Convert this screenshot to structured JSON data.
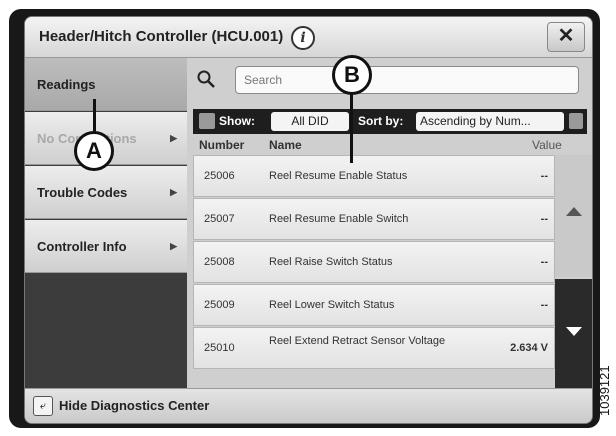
{
  "window": {
    "title": "Header/Hitch Controller (HCU.001)",
    "close_label": "✕"
  },
  "sidebar": {
    "items": [
      {
        "label": "Readings",
        "state": "active"
      },
      {
        "label": "No Connections",
        "state": "disabled"
      },
      {
        "label": "Trouble Codes",
        "state": "normal"
      },
      {
        "label": "Controller Info",
        "state": "normal"
      }
    ]
  },
  "search": {
    "placeholder": "Search"
  },
  "filter": {
    "show_label": "Show:",
    "show_value": "All DID",
    "sort_label": "Sort by:",
    "sort_value": "Ascending by Num..."
  },
  "table": {
    "headers": {
      "number": "Number",
      "name": "Name",
      "value": "Value"
    },
    "rows": [
      {
        "number": "25006",
        "name": "Reel Resume Enable Status",
        "value": "--"
      },
      {
        "number": "25007",
        "name": "Reel Resume Enable Switch",
        "value": "--"
      },
      {
        "number": "25008",
        "name": "Reel Raise Switch Status",
        "value": "--"
      },
      {
        "number": "25009",
        "name": "Reel Lower Switch Status",
        "value": "--"
      },
      {
        "number": "25010",
        "name": "Reel Extend Retract Sensor Voltage",
        "value": "2.634 V"
      }
    ]
  },
  "footer": {
    "hide_label": "Hide Diagnostics Center"
  },
  "callouts": {
    "a": "A",
    "b": "B"
  },
  "figure_number": "1039121",
  "icons": [
    "info-icon",
    "close-icon",
    "search-icon",
    "filter-icon",
    "export-icon",
    "scroll-up-icon",
    "scroll-down-icon",
    "hide-diagnostics-icon"
  ]
}
